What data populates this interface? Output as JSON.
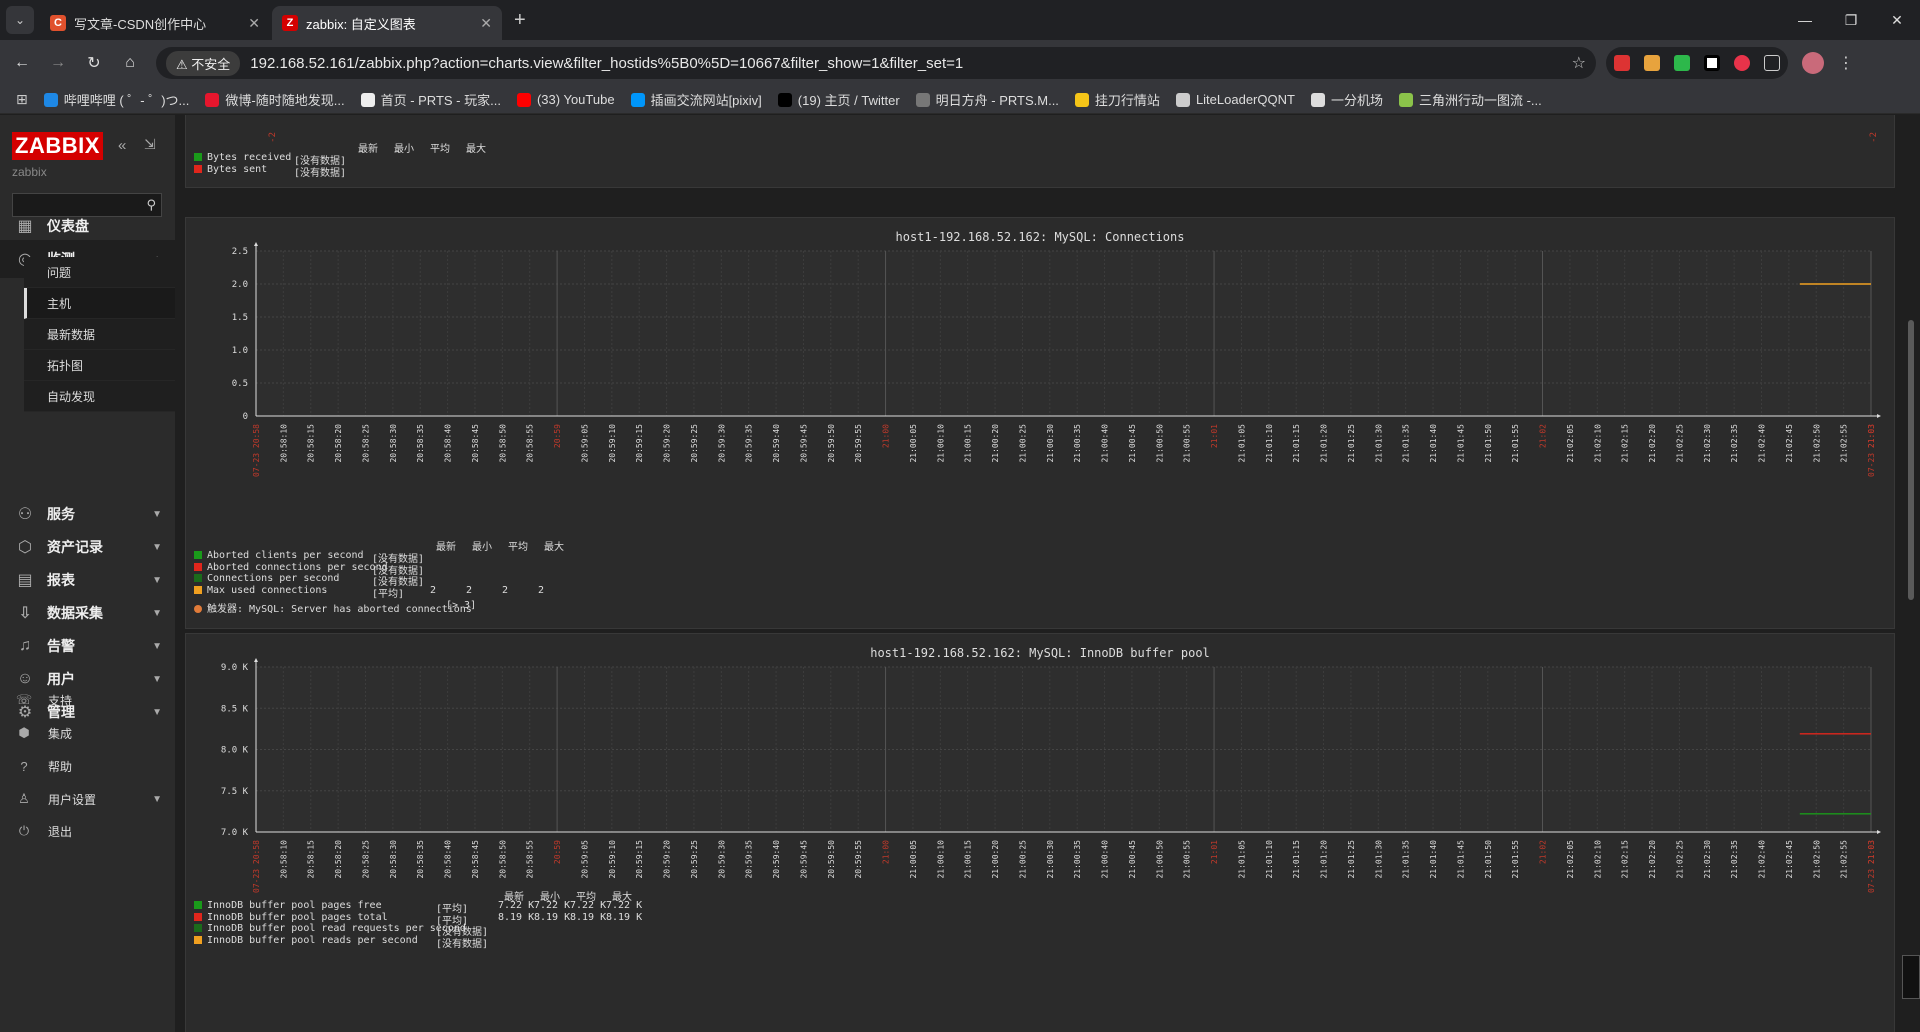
{
  "browser": {
    "tabs": [
      {
        "title": "写文章-CSDN创作中心",
        "icon_letter": "C",
        "icon_color": "#e0512d",
        "active": false
      },
      {
        "title": "zabbix: 自定义图表",
        "icon_letter": "Z",
        "icon_color": "#d40000",
        "active": true
      }
    ],
    "insecure_label": "不安全",
    "url": "192.168.52.161/zabbix.php?action=charts.view&filter_hostids%5B0%5D=10667&filter_show=1&filter_set=1",
    "bookmarks": [
      {
        "label": "哔哩哔哩 ( ゜- ゜)つ...",
        "color": "#1e88e5"
      },
      {
        "label": "微博-随时随地发现...",
        "color": "#e6162d"
      },
      {
        "label": "首页 - PRTS - 玩家...",
        "color": "#eeeeee"
      },
      {
        "label": "(33) YouTube",
        "color": "#ff0000"
      },
      {
        "label": "插画交流网站[pixiv]",
        "color": "#0096fa"
      },
      {
        "label": "(19) 主页 / Twitter",
        "color": "#000000"
      },
      {
        "label": "明日方舟 - PRTS.M...",
        "color": "#777777"
      },
      {
        "label": "挂刀行情站",
        "color": "#f5c518"
      },
      {
        "label": "LiteLoaderQQNT",
        "color": "#cccccc"
      },
      {
        "label": "一分机场",
        "color": "#dddddd"
      },
      {
        "label": "三角洲行动一图流 -...",
        "color": "#8bc34a"
      }
    ]
  },
  "sidebar": {
    "logo": "ZABBIX",
    "server_name": "zabbix",
    "menu": [
      {
        "label": "仪表盘",
        "icon": "dashboard-icon",
        "glyph": "▦",
        "expandable": false
      },
      {
        "label": "监测",
        "icon": "monitoring-icon",
        "glyph": "◎",
        "expandable": true,
        "open": true
      },
      {
        "label": "服务",
        "icon": "services-icon",
        "glyph": "⚇",
        "expandable": true
      },
      {
        "label": "资产记录",
        "icon": "inventory-icon",
        "glyph": "⬡",
        "expandable": true
      },
      {
        "label": "报表",
        "icon": "reports-icon",
        "glyph": "▤",
        "expandable": true
      },
      {
        "label": "数据采集",
        "icon": "data-collection-icon",
        "glyph": "⇩",
        "expandable": true
      },
      {
        "label": "告警",
        "icon": "alerts-icon",
        "glyph": "♫",
        "expandable": true
      },
      {
        "label": "用户",
        "icon": "users-icon",
        "glyph": "☺",
        "expandable": true
      },
      {
        "label": "管理",
        "icon": "administration-icon",
        "glyph": "⚙",
        "expandable": true
      }
    ],
    "submenu": [
      {
        "label": "问题",
        "selected": false
      },
      {
        "label": "主机",
        "selected": true
      },
      {
        "label": "最新数据",
        "selected": false
      },
      {
        "label": "拓扑图",
        "selected": false
      },
      {
        "label": "自动发现",
        "selected": false
      }
    ],
    "bottom": [
      {
        "label": "支持",
        "icon": "support-icon",
        "glyph": "☏",
        "expandable": false
      },
      {
        "label": "集成",
        "icon": "integrations-icon",
        "glyph": "⬢",
        "expandable": false
      },
      {
        "label": "帮助",
        "icon": "help-icon",
        "glyph": "?",
        "expandable": false
      },
      {
        "label": "用户设置",
        "icon": "user-settings-icon",
        "glyph": "♙",
        "expandable": true
      },
      {
        "label": "退出",
        "icon": "sign-out-icon",
        "glyph": "⏻",
        "expandable": false
      }
    ]
  },
  "colors": {
    "green": "#1a9a1a",
    "red": "#e0261c",
    "dark_green": "#1b6b1b",
    "orange": "#f0a020",
    "axis_red": "#c0392b"
  },
  "legend_headers": [
    "最新",
    "最小",
    "平均",
    "最大"
  ],
  "graph_top": {
    "items": [
      {
        "name": "Bytes received",
        "color": "#1a9a1a",
        "values": [
          "[没有数据]"
        ]
      },
      {
        "name": "Bytes sent",
        "color": "#e0261c",
        "values": [
          "[没有数据]"
        ]
      }
    ]
  },
  "graph_connections": {
    "title": "host1-192.168.52.162: MySQL: Connections",
    "items": [
      {
        "name": "Aborted clients per second",
        "color": "#1a9a1a",
        "values": [
          "[没有数据]"
        ]
      },
      {
        "name": "Aborted connections per second",
        "color": "#e0261c",
        "values": [
          "[没有数据]"
        ]
      },
      {
        "name": "Connections per second",
        "color": "#1b6b1b",
        "values": [
          "[没有数据]"
        ]
      },
      {
        "name": "Max used connections",
        "color": "#f0a020",
        "values": [
          "[平均]",
          "2",
          "2",
          "2",
          "2"
        ]
      }
    ],
    "trigger": "触发器: MySQL: Server has aborted connections",
    "trigger_value": "[> 3]"
  },
  "graph_innodb": {
    "title": "host1-192.168.52.162: MySQL: InnoDB buffer pool",
    "items": [
      {
        "name": "InnoDB buffer pool pages free",
        "color": "#1a9a1a",
        "values": [
          "[平均]",
          "7.22 K",
          "7.22 K",
          "7.22 K",
          "7.22 K"
        ]
      },
      {
        "name": "InnoDB buffer pool pages total",
        "color": "#e0261c",
        "values": [
          "[平均]",
          "8.19 K",
          "8.19 K",
          "8.19 K",
          "8.19 K"
        ]
      },
      {
        "name": "InnoDB buffer pool read requests per second",
        "color": "#1b6b1b",
        "values": [
          "[没有数据]"
        ]
      },
      {
        "name": "InnoDB buffer pool reads per second",
        "color": "#f0a020",
        "values": [
          "[没有数据]"
        ]
      }
    ]
  },
  "chart_data": [
    {
      "type": "line",
      "title": "host1-192.168.52.162: MySQL: Connections",
      "y_ticks": [
        "2.5",
        "2.0",
        "1.5",
        "1.0",
        "0.5",
        "0"
      ],
      "ylim": [
        0,
        2.5
      ],
      "x_start_label": "07-23 20:58",
      "x_end_label": "07-23 21:03",
      "x_ticks": [
        "20:58:10",
        "20:58:15",
        "20:58:20",
        "20:58:25",
        "20:58:30",
        "20:58:35",
        "20:58:40",
        "20:58:45",
        "20:58:50",
        "20:58:55",
        "20:59",
        "20:59:05",
        "20:59:10",
        "20:59:15",
        "20:59:20",
        "20:59:25",
        "20:59:30",
        "20:59:35",
        "20:59:40",
        "20:59:45",
        "20:59:50",
        "20:59:55",
        "21:00",
        "21:00:05",
        "21:00:10",
        "21:00:15",
        "21:00:20",
        "21:00:25",
        "21:00:30",
        "21:00:35",
        "21:00:40",
        "21:00:45",
        "21:00:50",
        "21:00:55",
        "21:01",
        "21:01:05",
        "21:01:10",
        "21:01:15",
        "21:01:20",
        "21:01:25",
        "21:01:30",
        "21:01:35",
        "21:01:40",
        "21:01:45",
        "21:01:50",
        "21:01:55",
        "21:02",
        "21:02:05",
        "21:02:10",
        "21:02:15",
        "21:02:20",
        "21:02:25",
        "21:02:30",
        "21:02:35",
        "21:02:40",
        "21:02:45",
        "21:02:50",
        "21:02:55",
        "21:03"
      ],
      "major_ticks": [
        "20:59",
        "21:00",
        "21:01",
        "21:02",
        "21:03"
      ],
      "series": [
        {
          "name": "Max used connections",
          "color": "#f0a020",
          "x": [
            "21:02:47",
            "21:03"
          ],
          "values": [
            2,
            2
          ]
        }
      ]
    },
    {
      "type": "line",
      "title": "host1-192.168.52.162: MySQL: InnoDB buffer pool",
      "y_ticks": [
        "9.0 K",
        "8.5 K",
        "8.0 K",
        "7.5 K",
        "7.0 K"
      ],
      "ylim": [
        7000,
        9000
      ],
      "x_start_label": "07-23 20:58",
      "x_end_label": "07-23 21:03",
      "x_ticks": [
        "20:58:10",
        "20:58:15",
        "20:58:20",
        "20:58:25",
        "20:58:30",
        "20:58:35",
        "20:58:40",
        "20:58:45",
        "20:58:50",
        "20:58:55",
        "20:59",
        "20:59:05",
        "20:59:10",
        "20:59:15",
        "20:59:20",
        "20:59:25",
        "20:59:30",
        "20:59:35",
        "20:59:40",
        "20:59:45",
        "20:59:50",
        "20:59:55",
        "21:00",
        "21:00:05",
        "21:00:10",
        "21:00:15",
        "21:00:20",
        "21:00:25",
        "21:00:30",
        "21:00:35",
        "21:00:40",
        "21:00:45",
        "21:00:50",
        "21:00:55",
        "21:01",
        "21:01:05",
        "21:01:10",
        "21:01:15",
        "21:01:20",
        "21:01:25",
        "21:01:30",
        "21:01:35",
        "21:01:40",
        "21:01:45",
        "21:01:50",
        "21:01:55",
        "21:02",
        "21:02:05",
        "21:02:10",
        "21:02:15",
        "21:02:20",
        "21:02:25",
        "21:02:30",
        "21:02:35",
        "21:02:40",
        "21:02:45",
        "21:02:50",
        "21:02:55",
        "21:03"
      ],
      "major_ticks": [
        "20:59",
        "21:00",
        "21:01",
        "21:02",
        "21:03"
      ],
      "series": [
        {
          "name": "InnoDB buffer pool pages total",
          "color": "#e0261c",
          "x": [
            "21:02:47",
            "21:03"
          ],
          "values": [
            8190,
            8190
          ]
        },
        {
          "name": "InnoDB buffer pool pages free",
          "color": "#1a9a1a",
          "x": [
            "21:02:47",
            "21:03"
          ],
          "values": [
            7220,
            7220
          ]
        }
      ]
    }
  ]
}
